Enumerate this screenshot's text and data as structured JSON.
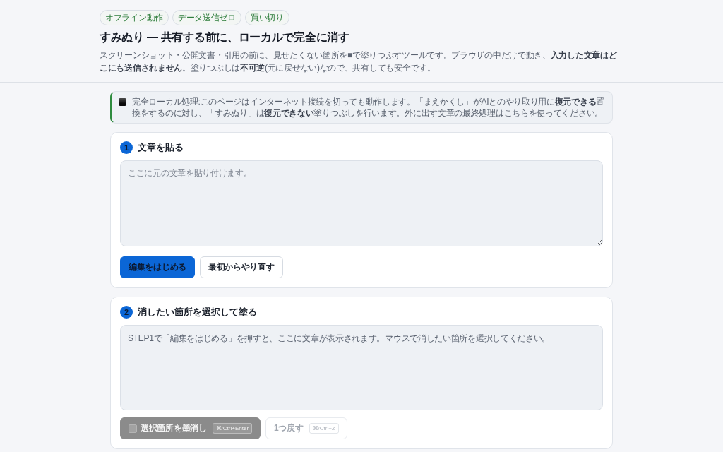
{
  "header": {
    "badges": [
      "オフライン動作",
      "データ送信ゼロ",
      "買い切り"
    ],
    "title": "すみぬり — 共有する前に、ローカルで完全に消す",
    "description": "スクリーンショット・公開文書・引用の前に、見せたくない箇所を■で塗りつぶすツールです。ブラウザの中だけで動き、**入力した文章はどこにも送信されません**。塗りつぶしは**不可逆**(元に戻せない)なので、共有しても安全です。"
  },
  "notice": {
    "text": "完全ローカル処理:このページはインターネット接続を切っても動作します。「まえかくし」がAIとのやり取り用に**復元できる**置換をするのに対し、「すみぬり」は**復元できない**塗りつぶしを行います。外に出す文章の最終処理はこちらを使ってください。"
  },
  "steps": [
    {
      "number": "1",
      "title": "文章を貼る",
      "field": {
        "kind": "textarea",
        "placeholder": "ここに元の文章を貼り付けます。"
      },
      "buttons": [
        {
          "kind": "primary",
          "label": "編集をはじめる",
          "disabled": false
        },
        {
          "kind": "secondary",
          "label": "最初からやり直す",
          "disabled": false
        }
      ]
    },
    {
      "number": "2",
      "title": "消したい箇所を選択して塗る",
      "field": {
        "kind": "preview",
        "text": "STEP1で「編集をはじめる」を押すと、ここに文章が表示されます。マウスで消したい箇所を選択してください。"
      },
      "buttons": [
        {
          "kind": "ink",
          "label": "選択箇所を墨消し",
          "shortcut": "⌘/Ctrl+Enter",
          "disabled": true
        },
        {
          "kind": "secondary",
          "label": "1つ戻す",
          "shortcut": "⌘/Ctrl+Z",
          "disabled": true
        }
      ]
    }
  ]
}
